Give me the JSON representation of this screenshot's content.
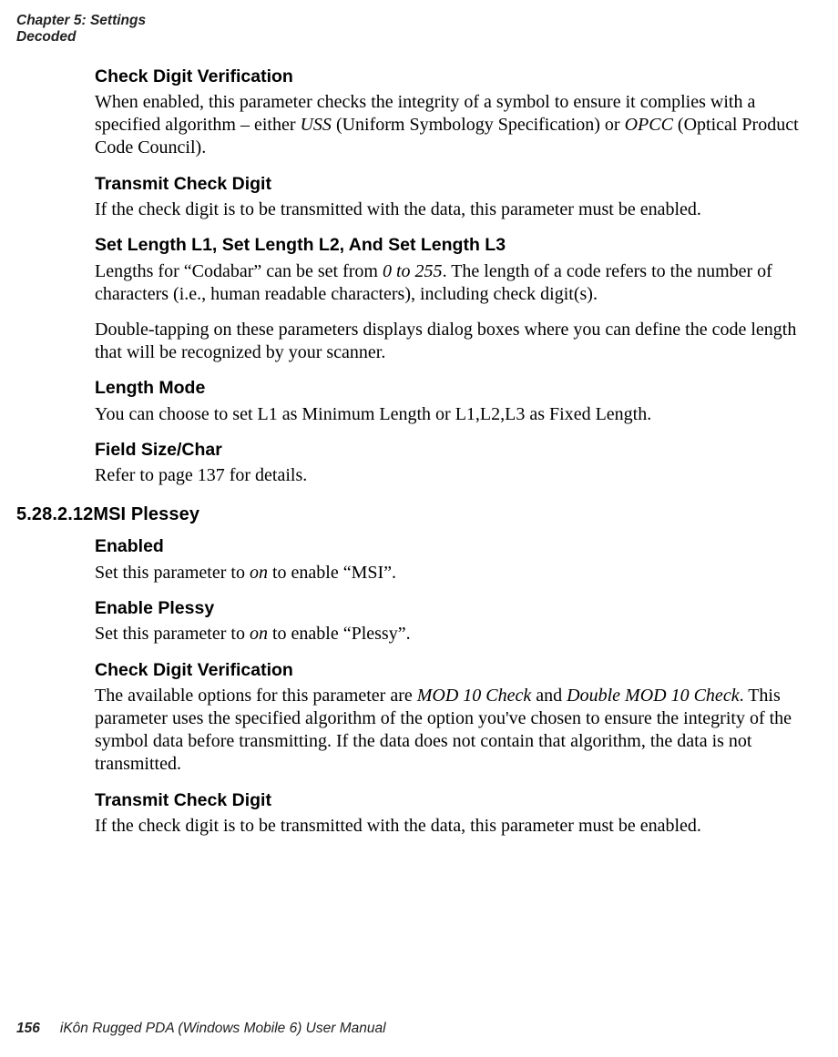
{
  "running_head": {
    "line1": "Chapter 5: Settings",
    "line2": "Decoded"
  },
  "sections": {
    "cdv1": {
      "title": "Check Digit Verification",
      "body_pre": "When enabled, this parameter checks the integrity of a symbol to ensure it complies with a specified algorithm – either ",
      "uss": "USS",
      "body_mid1": " (Uniform Symbology Specification) or ",
      "opcc": "OPCC",
      "body_post": " (Optical Product Code Council)."
    },
    "tcd1": {
      "title": "Transmit Check Digit",
      "body": "If the check digit is to be transmitted with the data, this parameter must be enabled."
    },
    "setlen": {
      "title": "Set Length L1, Set Length L2, And Set Length L3",
      "p1_pre": "Lengths for “Codabar” can be set from ",
      "p1_range": "0 to 255",
      "p1_post": ". The length of a code refers to the number of characters (i.e., human readable characters), including check digit(s).",
      "p2": "Double-tapping on these parameters displays dialog boxes where you can define the code length that will be recognized by your scanner."
    },
    "lenmode": {
      "title": "Length Mode",
      "body": "You can choose to set L1 as Minimum Length or L1,L2,L3 as Fixed Length."
    },
    "fsize": {
      "title": "Field Size/Char",
      "body": "Refer to page 137 for details."
    },
    "msi_header": {
      "number": "5.28.2.12",
      "title": "MSI Plessey"
    },
    "enabled": {
      "title": "Enabled",
      "pre": "Set this parameter to ",
      "on": "on",
      "post": " to enable “MSI”."
    },
    "eplessy": {
      "title": "Enable Plessy",
      "pre": "Set this parameter to ",
      "on": "on",
      "post": " to enable “Plessy”."
    },
    "cdv2": {
      "title": "Check Digit Verification",
      "pre": "The available options for this parameter are ",
      "alg1": "MOD 10 Check",
      "mid": " and ",
      "alg2": "Double MOD 10 Check",
      "post": ". This parameter uses the specified algorithm of the option you've chosen to ensure the integ­rity of the symbol data before transmitting. If the data does not contain that algorithm, the data is not transmitted."
    },
    "tcd2": {
      "title": "Transmit Check Digit",
      "body": "If the check digit is to be transmitted with the data, this parameter must be enabled."
    }
  },
  "footer": {
    "page": "156",
    "book": "iKôn Rugged PDA (Windows Mobile 6) User Manual"
  }
}
